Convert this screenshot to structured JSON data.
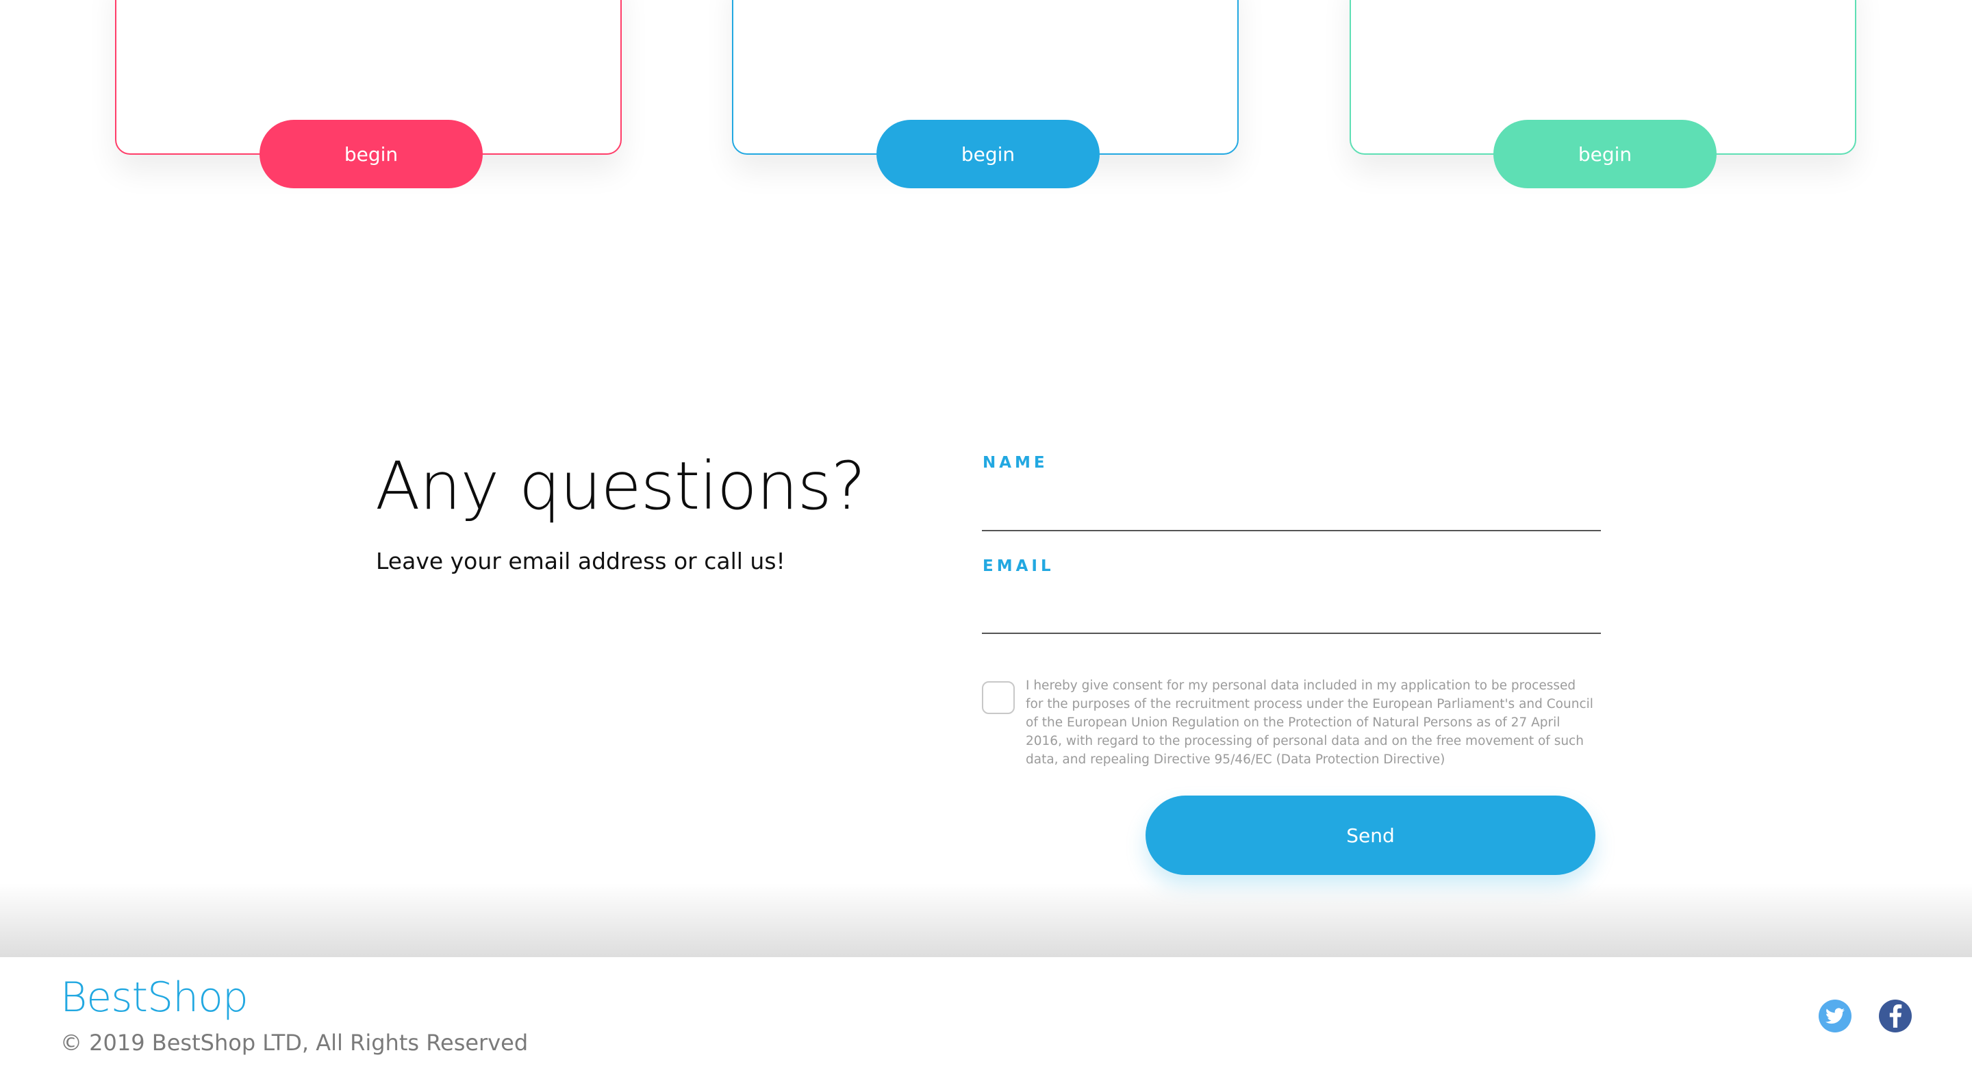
{
  "pricing_cards": [
    {
      "button_label": "begin",
      "color": "#ff3d69"
    },
    {
      "button_label": "begin",
      "color": "#22a8e1"
    },
    {
      "button_label": "begin",
      "color": "#5edfb4"
    }
  ],
  "contact": {
    "title": "Any questions?",
    "subtitle": "Leave your email address or call us!",
    "name_label": "NAME",
    "name_value": "",
    "email_label": "EMAIL",
    "email_value": "",
    "consent_checked": false,
    "consent_text": "I hereby give consent for my personal data included in my application to be processed for the purposes of the recruitment process under the European Parliament's and Council of the European Union Regulation on the Protection of Natural Persons as of 27 April 2016, with regard to the processing of personal data and on the free movement of such data, and repealing Directive 95/46/EC (Data Protection Directive)",
    "send_label": "Send",
    "accent_color": "#22a8e1"
  },
  "footer": {
    "brand": "BestShop",
    "copyright": "© 2019 BestShop LTD, All Rights Reserved",
    "social": [
      {
        "icon": "twitter-icon",
        "color": "#55acee"
      },
      {
        "icon": "facebook-icon",
        "color": "#3b5998"
      }
    ]
  }
}
